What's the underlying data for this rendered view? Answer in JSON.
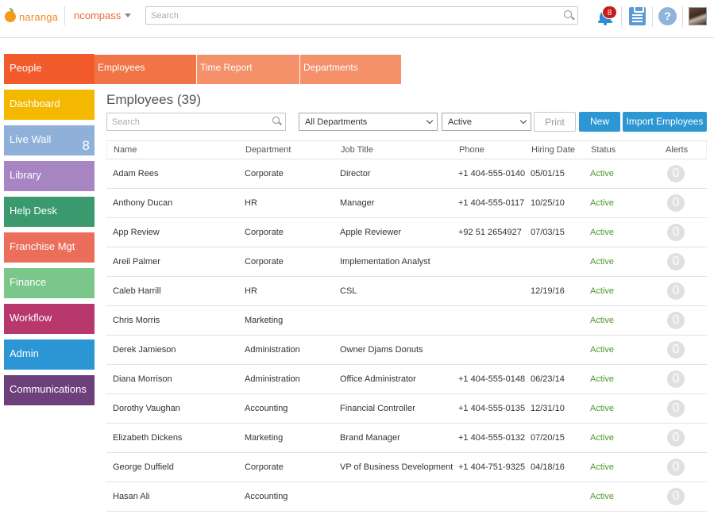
{
  "header": {
    "logo_text": "naranga",
    "app_name": "ncompass",
    "search_placeholder": "Search",
    "notification_count": "8",
    "help_label": "?"
  },
  "sidebar": {
    "items": [
      {
        "label": "People",
        "color": "#f15a2b"
      },
      {
        "label": "Dashboard",
        "color": "#f5b800"
      },
      {
        "label": "Live Wall",
        "color": "#8fb1d9",
        "count": "8"
      },
      {
        "label": "Library",
        "color": "#a784c2"
      },
      {
        "label": "Help Desk",
        "color": "#3a9a6e"
      },
      {
        "label": "Franchise Mgt",
        "color": "#ea6e5a"
      },
      {
        "label": "Finance",
        "color": "#7bc68b"
      },
      {
        "label": "Workflow",
        "color": "#b8376c"
      },
      {
        "label": "Admin",
        "color": "#2b96d3"
      },
      {
        "label": "Communications",
        "color": "#6d3f7b"
      }
    ]
  },
  "tabs": [
    {
      "label": "Employees",
      "color": "#f07445"
    },
    {
      "label": "Time Report",
      "color": "#f4906a"
    },
    {
      "label": "Departments",
      "color": "#f4906a"
    }
  ],
  "main": {
    "title": "Employees (39)",
    "search_placeholder": "Search",
    "department_filter": "All Departments",
    "status_filter": "Active",
    "print_label": "Print",
    "new_label": "New",
    "import_label": "Import Employees"
  },
  "table": {
    "columns": [
      "Name",
      "Department",
      "Job Title",
      "Phone",
      "Hiring Date",
      "Status",
      "Alerts"
    ],
    "rows": [
      {
        "name": "Adam Rees",
        "department": "Corporate",
        "job": "Director",
        "phone": "+1 404-555-0140",
        "hire": "05/01/15",
        "status": "Active",
        "alerts": "0"
      },
      {
        "name": "Anthony Ducan",
        "department": "HR",
        "job": "Manager",
        "phone": "+1 404-555-0117",
        "hire": "10/25/10",
        "status": "Active",
        "alerts": "0"
      },
      {
        "name": "App Review",
        "department": "Corporate",
        "job": "Apple Reviewer",
        "phone": "+92 51 2654927",
        "hire": "07/03/15",
        "status": "Active",
        "alerts": "0"
      },
      {
        "name": "Areil Palmer",
        "department": "Corporate",
        "job": "Implementation Analyst",
        "phone": "",
        "hire": "",
        "status": "Active",
        "alerts": "0"
      },
      {
        "name": "Caleb Harrill",
        "department": "HR",
        "job": "CSL",
        "phone": "",
        "hire": "12/19/16",
        "status": "Active",
        "alerts": "0"
      },
      {
        "name": "Chris Morris",
        "department": "Marketing",
        "job": "",
        "phone": "",
        "hire": "",
        "status": "Active",
        "alerts": "0"
      },
      {
        "name": "Derek Jamieson",
        "department": "Administration",
        "job": "Owner Djams Donuts",
        "phone": "",
        "hire": "",
        "status": "Active",
        "alerts": "0"
      },
      {
        "name": "Diana Morrison",
        "department": "Administration",
        "job": "Office Administrator",
        "phone": "+1 404-555-0148",
        "hire": "06/23/14",
        "status": "Active",
        "alerts": "0"
      },
      {
        "name": "Dorothy Vaughan",
        "department": "Accounting",
        "job": "Financial Controller",
        "phone": "+1 404-555-0135",
        "hire": "12/31/10",
        "status": "Active",
        "alerts": "0"
      },
      {
        "name": "Elizabeth Dickens",
        "department": "Marketing",
        "job": "Brand Manager",
        "phone": "+1 404-555-0132",
        "hire": "07/20/15",
        "status": "Active",
        "alerts": "0"
      },
      {
        "name": "George Duffield",
        "department": "Corporate",
        "job": "VP of Business Development",
        "phone": "+1 404-751-9325",
        "hire": "04/18/16",
        "status": "Active",
        "alerts": "0"
      },
      {
        "name": "Hasan Ali",
        "department": "Accounting",
        "job": "",
        "phone": "",
        "hire": "",
        "status": "Active",
        "alerts": "0"
      }
    ]
  }
}
